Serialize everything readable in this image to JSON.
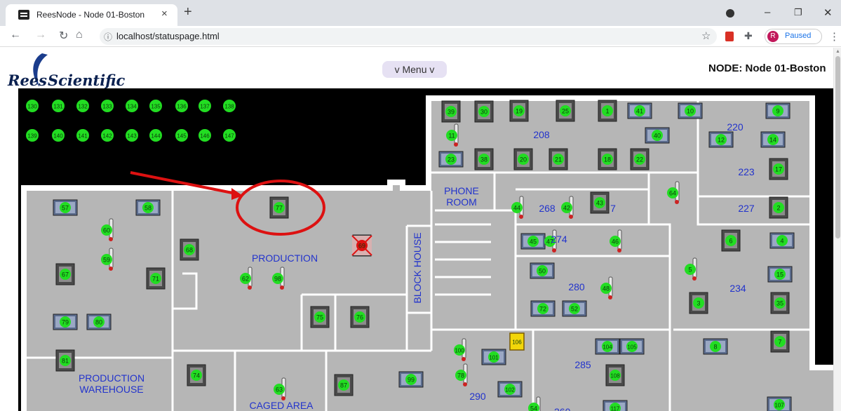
{
  "browser": {
    "tab_title": "ReesNode - Node 01-Boston",
    "tab_close": "×",
    "new_tab": "+",
    "url_info": "ⓘ",
    "url": "localhost/statuspage.html",
    "profile_initial": "R",
    "profile_status": "Paused",
    "colors": {
      "tabbar": "#dee1e6",
      "omnibox": "#f1f3f4",
      "profile_avatar": "#c2185b",
      "pdf_ext": "#d93025"
    }
  },
  "header": {
    "logo_word1": "Rees",
    "logo_word2": "Scientific",
    "menu_label": "v Menu v",
    "node_label": "NODE: Node 01-Boston"
  },
  "colors": {
    "map_background": "#000000",
    "floor": "#b6b6b6",
    "wall": "#ffffff",
    "room_label": "#2233cc",
    "sensor_ok": "#22dd22",
    "sensor_alarm": "#dd1111",
    "callout": "#dd1111",
    "door_highlight": "#f2d60a"
  },
  "unplaced_sensors": [
    "130",
    "131",
    "132",
    "133",
    "134",
    "135",
    "136",
    "137",
    "138",
    "139",
    "140",
    "141",
    "142",
    "143",
    "144",
    "145",
    "146",
    "147"
  ],
  "rooms": [
    {
      "label": "208"
    },
    {
      "label": "220"
    },
    {
      "label": "223"
    },
    {
      "label": "227"
    },
    {
      "label": "PHONE"
    },
    {
      "label": "ROOM"
    },
    {
      "label": "268"
    },
    {
      "label": "7"
    },
    {
      "label": "274"
    },
    {
      "label": "280"
    },
    {
      "label": "234"
    },
    {
      "label": "PRODUCTION"
    },
    {
      "label": "BLOCK HOUSE"
    },
    {
      "label": "285"
    },
    {
      "label": "290"
    },
    {
      "label": "PRODUCTION"
    },
    {
      "label": "WAREHOUSE"
    },
    {
      "label": "CAGED AREA"
    },
    {
      "label": "260"
    }
  ],
  "sensors": [
    {
      "id": "39",
      "icon": "freezer-icon",
      "status": "ok"
    },
    {
      "id": "30",
      "icon": "freezer-icon",
      "status": "ok"
    },
    {
      "id": "19",
      "icon": "freezer-icon",
      "status": "ok"
    },
    {
      "id": "25",
      "icon": "freezer-icon",
      "status": "ok"
    },
    {
      "id": "1",
      "icon": "freezer-icon",
      "status": "ok"
    },
    {
      "id": "41",
      "icon": "incubator-icon",
      "status": "ok"
    },
    {
      "id": "10",
      "icon": "incubator-icon",
      "status": "ok"
    },
    {
      "id": "9",
      "icon": "incubator-icon",
      "status": "ok"
    },
    {
      "id": "11",
      "icon": "thermometer-icon",
      "status": "ok"
    },
    {
      "id": "40",
      "icon": "incubator-icon",
      "status": "ok"
    },
    {
      "id": "12",
      "icon": "incubator-icon",
      "status": "ok"
    },
    {
      "id": "14",
      "icon": "incubator-icon",
      "status": "ok"
    },
    {
      "id": "23",
      "icon": "incubator-icon",
      "status": "ok"
    },
    {
      "id": "38",
      "icon": "freezer-icon",
      "status": "ok"
    },
    {
      "id": "20",
      "icon": "freezer-icon",
      "status": "ok"
    },
    {
      "id": "21",
      "icon": "freezer-icon",
      "status": "ok"
    },
    {
      "id": "18",
      "icon": "freezer-icon",
      "status": "ok"
    },
    {
      "id": "22",
      "icon": "freezer-icon",
      "status": "ok"
    },
    {
      "id": "17",
      "icon": "freezer-icon",
      "status": "ok"
    },
    {
      "id": "64",
      "icon": "thermometer-icon",
      "status": "ok"
    },
    {
      "id": "2",
      "icon": "freezer-icon",
      "status": "ok"
    },
    {
      "id": "57",
      "icon": "incubator-icon",
      "status": "ok"
    },
    {
      "id": "58",
      "icon": "incubator-icon",
      "status": "ok"
    },
    {
      "id": "77",
      "icon": "freezer-icon",
      "status": "ok"
    },
    {
      "id": "44",
      "icon": "thermometer-icon",
      "status": "ok"
    },
    {
      "id": "42",
      "icon": "thermometer-icon",
      "status": "ok"
    },
    {
      "id": "43",
      "icon": "freezer-icon",
      "status": "ok"
    },
    {
      "id": "60",
      "icon": "thermometer-icon",
      "status": "ok"
    },
    {
      "id": "68",
      "icon": "freezer-icon",
      "status": "ok"
    },
    {
      "id": "69",
      "icon": "freezer-icon",
      "status": "alarm"
    },
    {
      "id": "45",
      "icon": "incubator-icon",
      "status": "ok"
    },
    {
      "id": "47",
      "icon": "thermometer-icon",
      "status": "ok"
    },
    {
      "id": "46",
      "icon": "thermometer-icon",
      "status": "ok"
    },
    {
      "id": "6",
      "icon": "freezer-icon",
      "status": "ok"
    },
    {
      "id": "4",
      "icon": "incubator-icon",
      "status": "ok"
    },
    {
      "id": "59",
      "icon": "thermometer-icon",
      "status": "ok"
    },
    {
      "id": "67",
      "icon": "freezer-icon",
      "status": "ok"
    },
    {
      "id": "71",
      "icon": "freezer-icon",
      "status": "ok"
    },
    {
      "id": "62",
      "icon": "thermometer-icon",
      "status": "ok"
    },
    {
      "id": "98",
      "icon": "thermometer-icon",
      "status": "ok"
    },
    {
      "id": "50",
      "icon": "incubator-icon",
      "status": "ok"
    },
    {
      "id": "5",
      "icon": "thermometer-icon",
      "status": "ok"
    },
    {
      "id": "15",
      "icon": "incubator-icon",
      "status": "ok"
    },
    {
      "id": "48",
      "icon": "thermometer-icon",
      "status": "ok"
    },
    {
      "id": "3",
      "icon": "freezer-icon",
      "status": "ok"
    },
    {
      "id": "35",
      "icon": "freezer-icon",
      "status": "ok"
    },
    {
      "id": "75",
      "icon": "freezer-icon",
      "status": "ok"
    },
    {
      "id": "76",
      "icon": "freezer-icon",
      "status": "ok"
    },
    {
      "id": "72",
      "icon": "incubator-icon",
      "status": "ok"
    },
    {
      "id": "52",
      "icon": "incubator-icon",
      "status": "ok"
    },
    {
      "id": "79",
      "icon": "incubator-icon",
      "status": "ok"
    },
    {
      "id": "80",
      "icon": "incubator-icon",
      "status": "ok"
    },
    {
      "id": "7",
      "icon": "freezer-icon",
      "status": "ok"
    },
    {
      "id": "106",
      "icon": "door-icon",
      "status": "ok"
    },
    {
      "id": "100",
      "icon": "thermometer-icon",
      "status": "ok"
    },
    {
      "id": "101",
      "icon": "incubator-icon",
      "status": "ok"
    },
    {
      "id": "104",
      "icon": "incubator-icon",
      "status": "ok"
    },
    {
      "id": "105",
      "icon": "incubator-icon",
      "status": "ok"
    },
    {
      "id": "8",
      "icon": "incubator-icon",
      "status": "ok"
    },
    {
      "id": "81",
      "icon": "freezer-icon",
      "status": "ok"
    },
    {
      "id": "74",
      "icon": "freezer-icon",
      "status": "ok"
    },
    {
      "id": "87",
      "icon": "freezer-icon",
      "status": "ok"
    },
    {
      "id": "99",
      "icon": "incubator-icon",
      "status": "ok"
    },
    {
      "id": "78",
      "icon": "thermometer-icon",
      "status": "ok"
    },
    {
      "id": "108",
      "icon": "freezer-icon",
      "status": "ok"
    },
    {
      "id": "63",
      "icon": "thermometer-icon",
      "status": "ok"
    },
    {
      "id": "102",
      "icon": "incubator-icon",
      "status": "ok"
    },
    {
      "id": "54",
      "icon": "thermometer-icon",
      "status": "ok"
    },
    {
      "id": "117",
      "icon": "incubator-icon",
      "status": "ok"
    },
    {
      "id": "107",
      "icon": "incubator-icon",
      "status": "ok"
    }
  ]
}
